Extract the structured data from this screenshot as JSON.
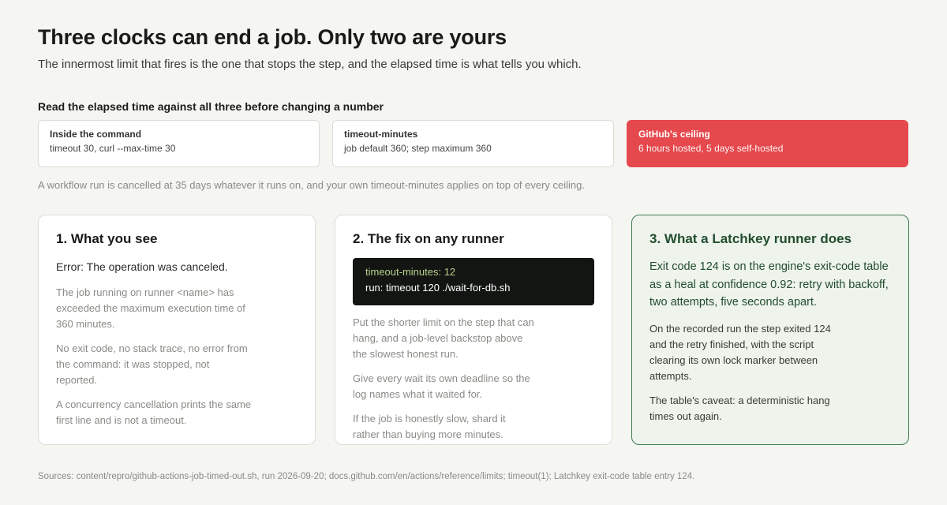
{
  "header": {
    "title": "Three clocks can end a job. Only two are yours",
    "subtitle": "The innermost limit that fires is the one that stops the step, and the elapsed time is what tells you which."
  },
  "clocks": {
    "heading": "Read the elapsed time against all three before changing a number",
    "items": [
      {
        "name": "Inside the command",
        "desc": "timeout 30, curl --max-time 30"
      },
      {
        "name": "timeout-minutes",
        "desc": "job default 360; step maximum 360"
      },
      {
        "name": "GitHub's ceiling",
        "desc": "6 hours hosted, 5 days self-hosted",
        "color": "#e5484d"
      }
    ],
    "note": "A workflow run is cancelled at 35 days whatever it runs on, and your own timeout-minutes applies on top of every ceiling."
  },
  "cards": {
    "see": {
      "title": "1. What you see",
      "lead": "Error: The operation was canceled.",
      "paras": [
        "The job running on runner <name> has exceeded the maximum execution time of 360 minutes.",
        "No exit code, no stack trace, no error from the command: it was stopped, not reported.",
        "A concurrency cancellation prints the same first line and is not a timeout."
      ]
    },
    "fix": {
      "title": "2. The fix on any runner",
      "code": [
        "timeout-minutes: 12",
        "run: timeout 120 ./wait-for-db.sh"
      ],
      "paras": [
        "Put the shorter limit on the step that can hang, and a job-level backstop above the slowest honest run.",
        "Give every wait its own deadline so the log names what it waited for.",
        "If the job is honestly slow, shard it rather than buying more minutes."
      ]
    },
    "latchkey": {
      "title": "3. What a Latchkey runner does",
      "lead": "Exit code 124 is on the engine's exit-code table as a heal at confidence 0.92: retry with backoff, two attempts, five seconds apart.",
      "paras": [
        "On the recorded run the step exited 124 and the retry finished, with the script clearing its own lock marker between attempts.",
        "The table's caveat: a deterministic hang times out again."
      ],
      "accent": "#3d7a4e"
    }
  },
  "footer": {
    "sources": "Sources: content/repro/github-actions-job-timed-out.sh, run 2026-09-20; docs.github.com/en/actions/reference/limits; timeout(1); Latchkey exit-code table entry 124."
  }
}
